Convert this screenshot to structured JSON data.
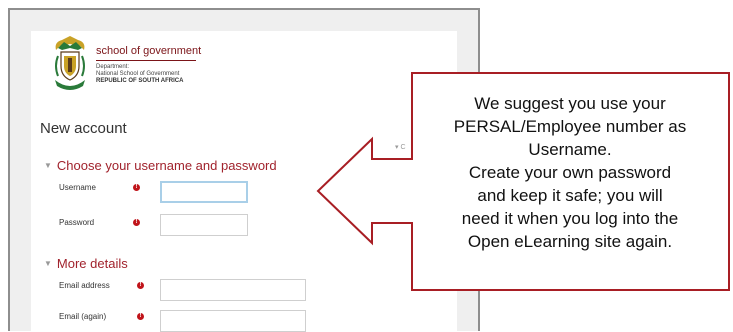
{
  "header": {
    "brand": "school of government",
    "department_lines": [
      "Department:",
      "National School of Government"
    ],
    "country": "REPUBLIC OF SOUTH AFRICA"
  },
  "form": {
    "title": "New account",
    "collapse_all": "▾ C",
    "required_marker": "!",
    "sections": [
      {
        "heading": "Choose your username and password",
        "fields": [
          {
            "label": "Username",
            "value": "",
            "focused": true
          },
          {
            "label": "Password",
            "value": ""
          }
        ]
      },
      {
        "heading": "More details",
        "fields": [
          {
            "label": "Email address",
            "value": ""
          },
          {
            "label": "Email (again)",
            "value": ""
          }
        ]
      }
    ]
  },
  "callout": {
    "lines": [
      "We suggest you use your",
      "PERSAL/Employee number as",
      "Username.",
      "Create your own password",
      "and keep it safe; you will",
      "need it when you log into the",
      "Open eLearning site again."
    ],
    "border_color": "#a81e24"
  },
  "colors": {
    "accent": "#a1232d",
    "required": "#c0141a",
    "focus": "#a9cfe8"
  },
  "icons": {
    "section_toggle": "chevron-down-icon",
    "required": "required-icon",
    "logo": "coat-of-arms-icon"
  }
}
